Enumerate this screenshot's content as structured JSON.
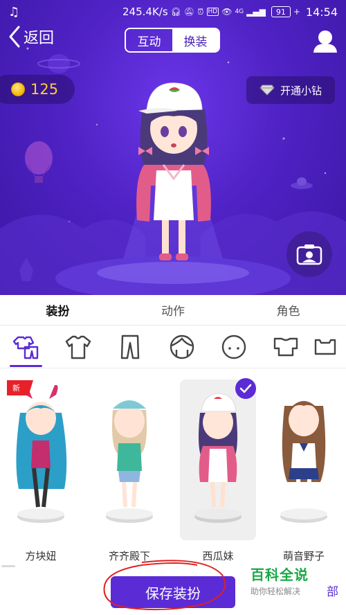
{
  "statusbar": {
    "network_speed": "245.4K/s",
    "network_type": "4G",
    "battery": "91",
    "time": "14:54"
  },
  "header": {
    "back_label": "返回",
    "mode_tabs": [
      {
        "label": "互动",
        "active": true
      },
      {
        "label": "换装",
        "active": false
      }
    ]
  },
  "stage": {
    "coin_count": "125",
    "vip_label": "开通小钻"
  },
  "main_tabs": [
    {
      "label": "装扮",
      "active": true
    },
    {
      "label": "动作",
      "active": false
    },
    {
      "label": "角色",
      "active": false
    }
  ],
  "categories": [
    {
      "name": "outfit-set-icon",
      "active": true
    },
    {
      "name": "tshirt-icon",
      "active": false
    },
    {
      "name": "pants-icon",
      "active": false
    },
    {
      "name": "hair-icon",
      "active": false
    },
    {
      "name": "face-icon",
      "active": false
    },
    {
      "name": "shorts-icon",
      "active": false
    },
    {
      "name": "top-icon",
      "active": false
    }
  ],
  "characters": [
    {
      "name": "方块妞",
      "badge": "新",
      "selected": false
    },
    {
      "name": "齐齐殿下",
      "badge": "",
      "selected": false
    },
    {
      "name": "西瓜妹",
      "badge": "",
      "selected": true
    },
    {
      "name": "萌音野子",
      "badge": "",
      "selected": false
    }
  ],
  "footer": {
    "save_label": "保存装扮",
    "extra_char": "部"
  },
  "watermark": {
    "title": "百科全说",
    "subtitle": "助你轻松解决"
  },
  "colors": {
    "accent": "#5b2bd6",
    "stage_bg": "#4f22c4",
    "coin": "#ffcf2e",
    "new_badge": "#e8202a",
    "annotation": "#e02020",
    "watermark": "#1aa846"
  }
}
